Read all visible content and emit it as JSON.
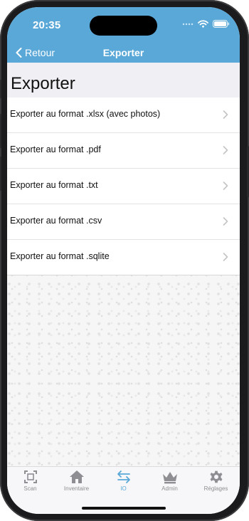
{
  "status_bar": {
    "time": "20:35"
  },
  "nav": {
    "back_label": "Retour",
    "title": "Exporter"
  },
  "page": {
    "large_title": "Exporter"
  },
  "export_items": [
    {
      "label": "Exporter au format .xlsx (avec photos)"
    },
    {
      "label": "Exporter au format .pdf"
    },
    {
      "label": "Exporter au format .txt"
    },
    {
      "label": "Exporter au format .csv"
    },
    {
      "label": "Exporter au format .sqlite"
    }
  ],
  "tabs": [
    {
      "label": "Scan",
      "icon": "scan-icon",
      "active": false
    },
    {
      "label": "Inventaire",
      "icon": "home-icon",
      "active": false
    },
    {
      "label": "IO",
      "icon": "import-export-arrows-icon",
      "active": true
    },
    {
      "label": "Admin",
      "icon": "crown-icon",
      "active": false
    },
    {
      "label": "Réglages",
      "icon": "gear-icon",
      "active": false
    }
  ],
  "colors": {
    "accent": "#5aa8d8",
    "inactive_tab": "#8e8e93",
    "list_background": "#ffffff",
    "title_background": "#efeff4"
  }
}
